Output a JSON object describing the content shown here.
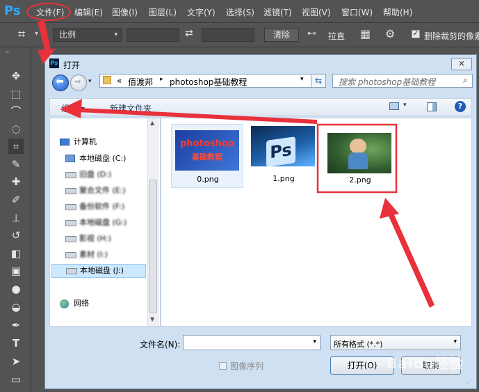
{
  "menubar": {
    "logo": "Ps",
    "items": [
      "文件(F)",
      "编辑(E)",
      "图像(I)",
      "图层(L)",
      "文字(Y)",
      "选择(S)",
      "滤镜(T)",
      "视图(V)",
      "窗口(W)",
      "帮助(H)"
    ]
  },
  "options": {
    "ratio_value": "比例",
    "clear_label": "清除",
    "straighten_label": "拉直",
    "delete_cropped_label": "删除裁剪的像素"
  },
  "dialog": {
    "title": "打开",
    "close_label": "✕",
    "address_parts": [
      "«",
      "佰渡邦",
      "▸",
      "photoshop基础教程"
    ],
    "search_placeholder": "搜索 photoshop基础教程",
    "organize_label": "组织 ▾",
    "new_folder_label": "新建文件夹",
    "nav": {
      "computer_label": "计算机",
      "drives": [
        "本地磁盘 (C:)",
        "旧盘 (D:)",
        "聚合文件 (E:)",
        "备份软件 (F:)",
        "本地磁盘 (G:)",
        "影视 (H:)",
        "素材 (I:)",
        "本地磁盘 (J:)"
      ],
      "network_label": "网络"
    },
    "files": [
      {
        "name": "0.png",
        "thumb_text_1": "photoshop",
        "thumb_text_2": "基础教程"
      },
      {
        "name": "1.png",
        "thumb_text_1": "Ps"
      },
      {
        "name": "2.png"
      }
    ],
    "filename_label": "文件名(N):",
    "filename_value": "",
    "filetype_value": "所有格式 (*.*)",
    "image_sequence_label": "图像序列",
    "open_label": "打开(O)",
    "cancel_label": "取消"
  },
  "watermark": "Baidu经验",
  "colors": {
    "accent_red": "#e8313b",
    "ps_blue": "#31a8ff",
    "selection_bg": "#cce8ff"
  }
}
